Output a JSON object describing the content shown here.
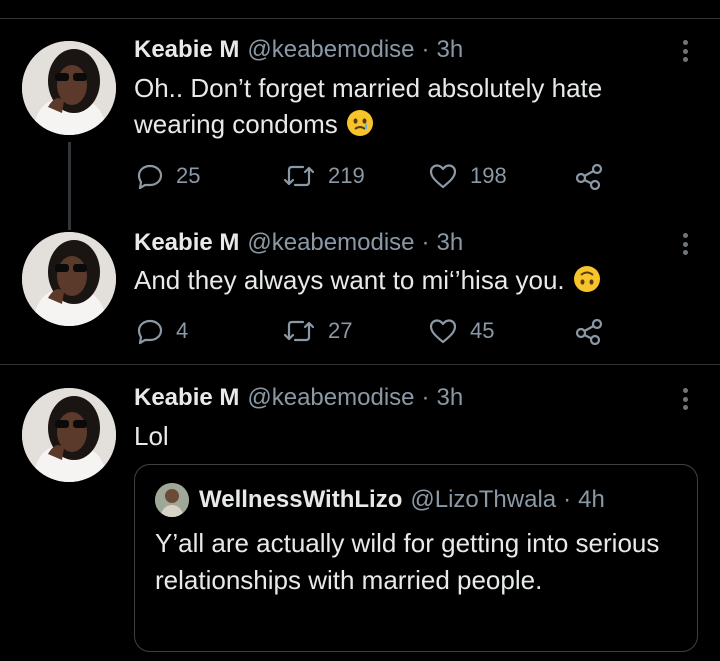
{
  "tweets": [
    {
      "name": "Keabie M",
      "handle": "@keabemodise",
      "separator": "·",
      "time": "3h",
      "text": "Oh.. Don’t forget married absolutely hate wearing condoms",
      "emoji": "crying-face-emoji",
      "replies": "25",
      "retweets": "219",
      "likes": "198"
    },
    {
      "name": "Keabie M",
      "handle": "@keabemodise",
      "separator": "·",
      "time": "3h",
      "text": "And they always want to mi‘’hisa you.",
      "emoji": "upside-down-face-emoji",
      "replies": "4",
      "retweets": "27",
      "likes": "45"
    },
    {
      "name": "Keabie M",
      "handle": "@keabemodise",
      "separator": "·",
      "time": "3h",
      "text": "Lol",
      "quoted": {
        "name": "WellnessWithLizo",
        "handle": "@LizoThwala",
        "separator": "·",
        "time": "4h",
        "text": "Y’all are actually wild for getting into serious relationships with married people."
      }
    }
  ],
  "icons": {
    "reply": "reply-icon",
    "retweet": "retweet-icon",
    "like": "heart-icon",
    "share": "share-icon",
    "more": "more-icon"
  },
  "colors": {
    "background": "#000000",
    "primary_text": "#e7e9ea",
    "secondary_text": "#8b98a5",
    "divider": "#2f3336"
  }
}
